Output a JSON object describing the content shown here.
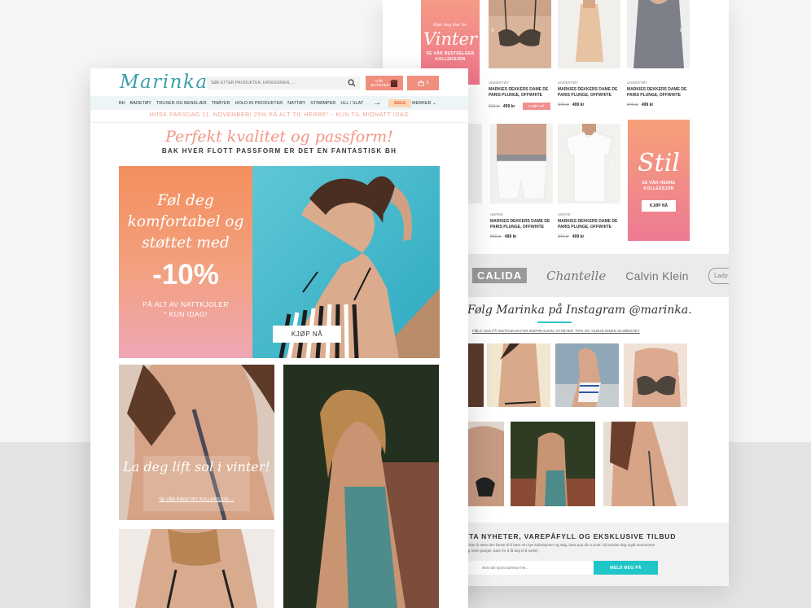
{
  "back_page": {
    "promo_vinter": {
      "kicker": "Gjør deg klar for",
      "title": "Vinter",
      "sub": "SE VÅR BESTSELGER KOLLEKSJON"
    },
    "promo_stil": {
      "title": "Stil",
      "sub": "SE VÅR HERRE KOLLEKSJON",
      "button": "KJØP NÅ"
    },
    "products_row1": [
      {
        "category": "UNDERTØY",
        "name": "MARKIES DEKKERS DAME DE PARIS PLUNGE, OFFWHITE",
        "old_price": "849 kr",
        "new_price": "499 kr",
        "button": "KJØP NÅ"
      },
      {
        "category": "UNDERTØY",
        "name": "MARKIES DEKKERS DAME DE PARIS PLUNGE, OFFWHITE",
        "old_price": "849 kr",
        "new_price": "499 kr"
      },
      {
        "category": "UNDERTØY",
        "name": "MARKIES DEKKERS DAME DE PARIS PLUNGE, OFFWHITE",
        "old_price": "849 kr",
        "new_price": "499 kr"
      }
    ],
    "products_row2": [
      {
        "category": "HERRE",
        "name": "MARKIES DEKKERS DAME DE PARIS PLUNGE, OFFWHITE",
        "old_price": "849 kr",
        "new_price": "499 kr"
      },
      {
        "category": "HERRE",
        "name": "MARKIES DEKKERS DAME DE PARIS PLUNGE, OFFWHITE",
        "old_price": "849 kr",
        "new_price": "499 kr"
      }
    ],
    "brands": [
      "CALIDA",
      "Chantelle",
      "Calvin Klein",
      "Lady Avenue"
    ],
    "instagram": {
      "title": "Følg Marinka på Instagram @marinka.",
      "sub": "FØLG OSS PÅ INSTAGRAM FOR INSPIRASJON, NYHETER, TIPS OG TILBUD INNEN SKJØNNHET"
    },
    "newsletter": {
      "title": "TTA NYHETER, VAREPÅFYLL OG EKSKLUSIVE TILBUD",
      "body": "ønsker å være den første til å høre om nye kolleksjoner og salg, bare pop din e-post i så sender deg også morsomme ting noen ganger, bare for å få deg til å smile).",
      "placeholder": "skriv din epost adresse her...",
      "button": "MELD MEG PÅ"
    }
  },
  "front_page": {
    "logo": "Marinka",
    "search_placeholder": "SØK ETTER PRODUKTER, KATEGORIER, ...",
    "store_button": "VÅR BUTIKKER",
    "cart_count": "0",
    "nav": [
      "BH",
      "BADETØY",
      "TRUSER OG BENKLÆR",
      "TRØYER",
      "HOLD-IN PRODUKTER",
      "NATTØY",
      "STRØMPER",
      "ULL / SLAT"
    ],
    "nav_sale": "SALG",
    "nav_brands": "MERKER",
    "announcement": "HUSK FARSDAG 11. NOVEMBER! 25% PÅ ALT TIL HERRE* - KUN TIL MIDNATT IDAG",
    "headline": "Perfekt kvalitet og passform!",
    "subheadline": "BAK HVER FLOTT PASSFORM ER DET EN FANTASTISK BH",
    "hero": {
      "script_line1": "Føl deg",
      "script_line2": "komfortabel og",
      "script_line3": "støttet med",
      "percent": "-10%",
      "small_line1": "PÅ ALT AV NATTKJOLER",
      "small_line2": "* KUN IDAG!",
      "button": "KJØP NÅ"
    },
    "tile1": {
      "script": "La deg lift sol i vinter!",
      "link": "SE VÅR BADETØY KOLLEKSJON"
    }
  },
  "colors": {
    "accent": "#3a9fa8",
    "coral": "#f08f7e",
    "teal_button": "#20c6c7",
    "sale": "#e2572b"
  }
}
